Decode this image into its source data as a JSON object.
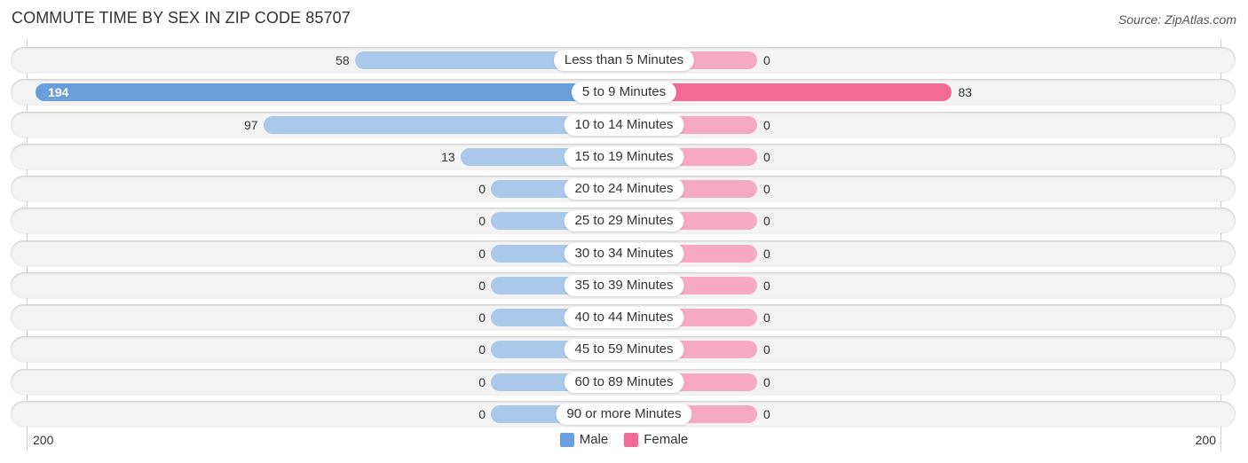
{
  "title": "COMMUTE TIME BY SEX IN ZIP CODE 85707",
  "source": "Source: ZipAtlas.com",
  "colors": {
    "male": "#a9c8ea",
    "male_strong": "#6a9fdb",
    "female": "#f6a9c2",
    "female_strong": "#f26a95"
  },
  "chart_data": {
    "type": "bar",
    "orientation": "horizontal-diverging",
    "title": "COMMUTE TIME BY SEX IN ZIP CODE 85707",
    "categories": [
      "Less than 5 Minutes",
      "5 to 9 Minutes",
      "10 to 14 Minutes",
      "15 to 19 Minutes",
      "20 to 24 Minutes",
      "25 to 29 Minutes",
      "30 to 34 Minutes",
      "35 to 39 Minutes",
      "40 to 44 Minutes",
      "45 to 59 Minutes",
      "60 to 89 Minutes",
      "90 or more Minutes"
    ],
    "series": [
      {
        "name": "Male",
        "values": [
          58,
          194,
          97,
          13,
          0,
          0,
          0,
          0,
          0,
          0,
          0,
          0
        ]
      },
      {
        "name": "Female",
        "values": [
          0,
          83,
          0,
          0,
          0,
          0,
          0,
          0,
          0,
          0,
          0,
          0
        ]
      }
    ],
    "axis": {
      "left_tick": "200",
      "right_tick": "200",
      "range": [
        -200,
        200
      ]
    },
    "legend": {
      "position": "bottom-center",
      "entries": [
        "Male",
        "Female"
      ]
    },
    "xlabel": "",
    "ylabel": ""
  }
}
